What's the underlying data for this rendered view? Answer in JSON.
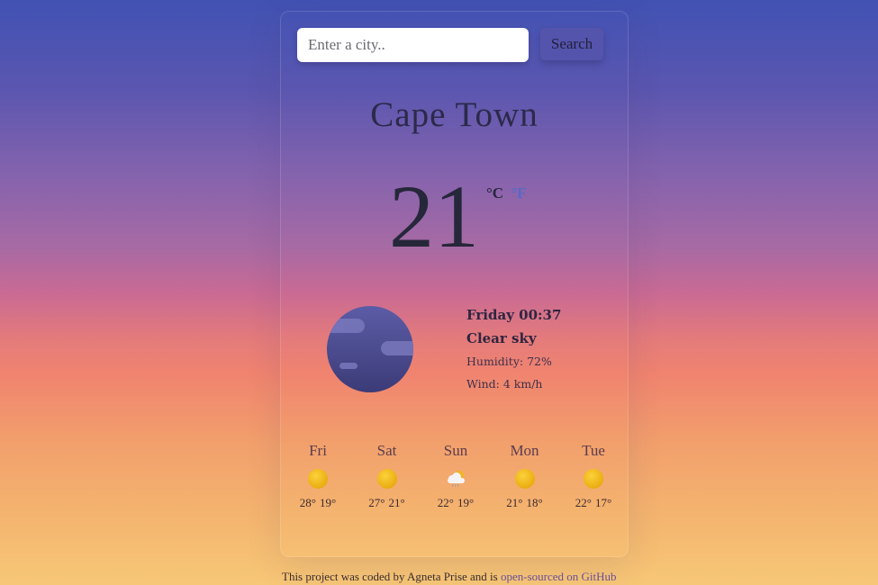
{
  "search": {
    "placeholder": "Enter a city..",
    "value": "",
    "button_label": "Search"
  },
  "current": {
    "city": "Cape Town",
    "temperature": "21",
    "unit_celsius": "°C",
    "unit_fahrenheit": "°F",
    "day_time": "Friday 00:37",
    "description": "Clear sky",
    "humidity": "Humidity: 72%",
    "wind": "Wind: 4 km/h",
    "icon": "clear-night-moon-icon"
  },
  "forecast": [
    {
      "day": "Fri",
      "icon": "sun-icon",
      "max": "28°",
      "min": "19°"
    },
    {
      "day": "Sat",
      "icon": "sun-icon",
      "max": "27°",
      "min": "21°"
    },
    {
      "day": "Sun",
      "icon": "cloud-rain-icon",
      "max": "22°",
      "min": "19°"
    },
    {
      "day": "Mon",
      "icon": "sun-icon",
      "max": "21°",
      "min": "18°"
    },
    {
      "day": "Tue",
      "icon": "sun-icon",
      "max": "22°",
      "min": "17°"
    }
  ],
  "footer": {
    "text": "This project was coded by Agneta Prise and is ",
    "link_text": "open-sourced on GitHub"
  },
  "colors": {
    "accent": "#5868c8",
    "button": "#5554ad",
    "gradient_top": "#4152b3",
    "gradient_bottom": "#f7c776"
  }
}
